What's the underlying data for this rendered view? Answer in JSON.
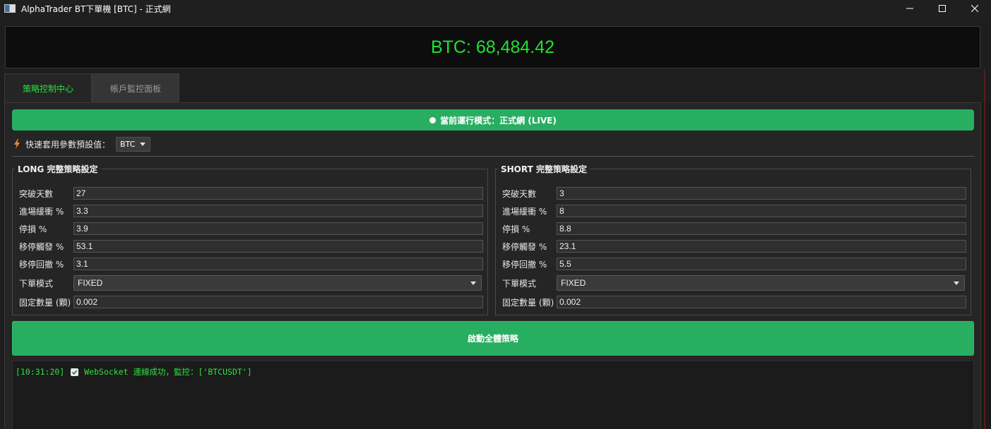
{
  "window": {
    "title": "AlphaTrader BT下單機 [BTC] - 正式網"
  },
  "price": {
    "text": "BTC: 68,484.42"
  },
  "tabs": [
    {
      "label": "策略控制中心",
      "active": true
    },
    {
      "label": "帳戶監控面板",
      "active": false
    }
  ],
  "mode_banner": {
    "text": "當前運行模式：正式網 (LIVE)"
  },
  "preset": {
    "label": "快速套用參數預設值：",
    "selected": "BTC"
  },
  "long": {
    "title": "LONG 完整策略設定",
    "fields": [
      {
        "label": "突破天數",
        "value": "27"
      },
      {
        "label": "進場緩衝 %",
        "value": "3.3"
      },
      {
        "label": "停損 %",
        "value": "3.9"
      },
      {
        "label": "移停觸發 %",
        "value": "53.1"
      },
      {
        "label": "移停回撤 %",
        "value": "3.1"
      }
    ],
    "order_mode": {
      "label": "下單模式",
      "value": "FIXED"
    },
    "fixed_qty": {
      "label": "固定數量 (顆)",
      "value": "0.002"
    }
  },
  "short": {
    "title": "SHORT 完整策略設定",
    "fields": [
      {
        "label": "突破天數",
        "value": "3"
      },
      {
        "label": "進場緩衝 %",
        "value": "8"
      },
      {
        "label": "停損 %",
        "value": "8.8"
      },
      {
        "label": "移停觸發 %",
        "value": "23.1"
      },
      {
        "label": "移停回撤 %",
        "value": "5.5"
      }
    ],
    "order_mode": {
      "label": "下單模式",
      "value": "FIXED"
    },
    "fixed_qty": {
      "label": "固定數量 (顆)",
      "value": "0.002"
    }
  },
  "start_button": {
    "label": "啟動全體策略"
  },
  "log": {
    "lines": [
      {
        "time": "[10:31:20]",
        "message": "WebSocket 連線成功，監控：['BTCUSDT']"
      }
    ]
  },
  "colors": {
    "accent_green": "#27ae60",
    "price_green": "#22e032",
    "log_green": "#2ee040"
  }
}
